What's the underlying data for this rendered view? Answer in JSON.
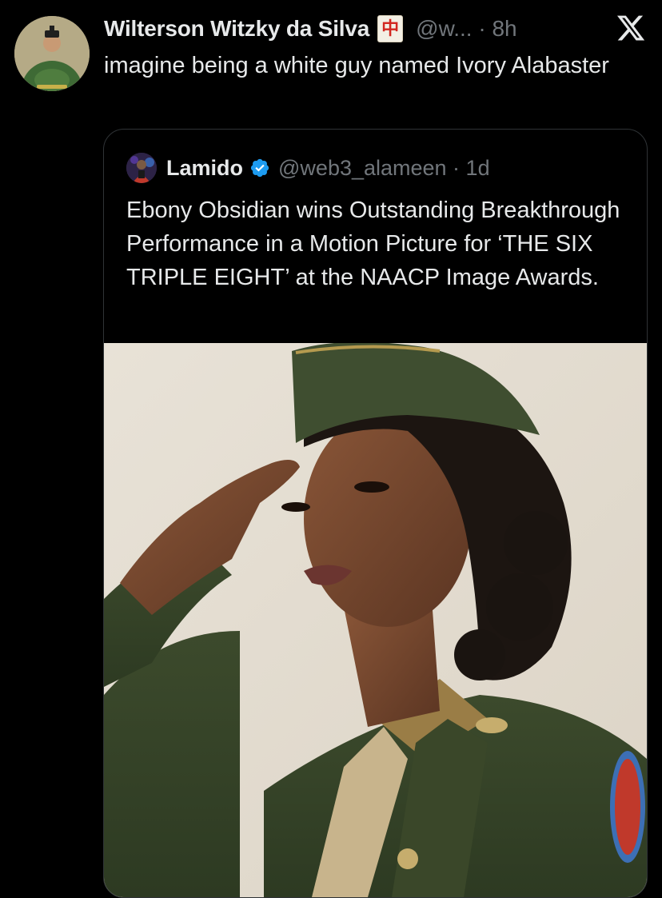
{
  "tweet": {
    "author_name": "Wilterson Witzky da Silva",
    "name_emoji_char": "中",
    "name_emoji_icon": "mahjong-red-dragon-icon",
    "handle_time": "@w... · 8h",
    "text": "imagine being a white guy named Ivory Alabaster"
  },
  "quoted_tweet": {
    "author_name": "Lamido",
    "verified_icon": "verified-badge-icon",
    "handle_time": "@web3_alameen · 1d",
    "text": "Ebony Obsidian wins Outstanding Breakthrough Performance in a Motion Picture for ‘THE SIX TRIPLE EIGHT’ at the NAACP Image Awards."
  },
  "icons": {
    "close": "x-logo-icon"
  },
  "colors": {
    "background": "#000000",
    "primary_text": "#e7e9ea",
    "secondary_text": "#71767b",
    "card_border": "#2f3336",
    "verified_blue": "#1d9bf0"
  }
}
